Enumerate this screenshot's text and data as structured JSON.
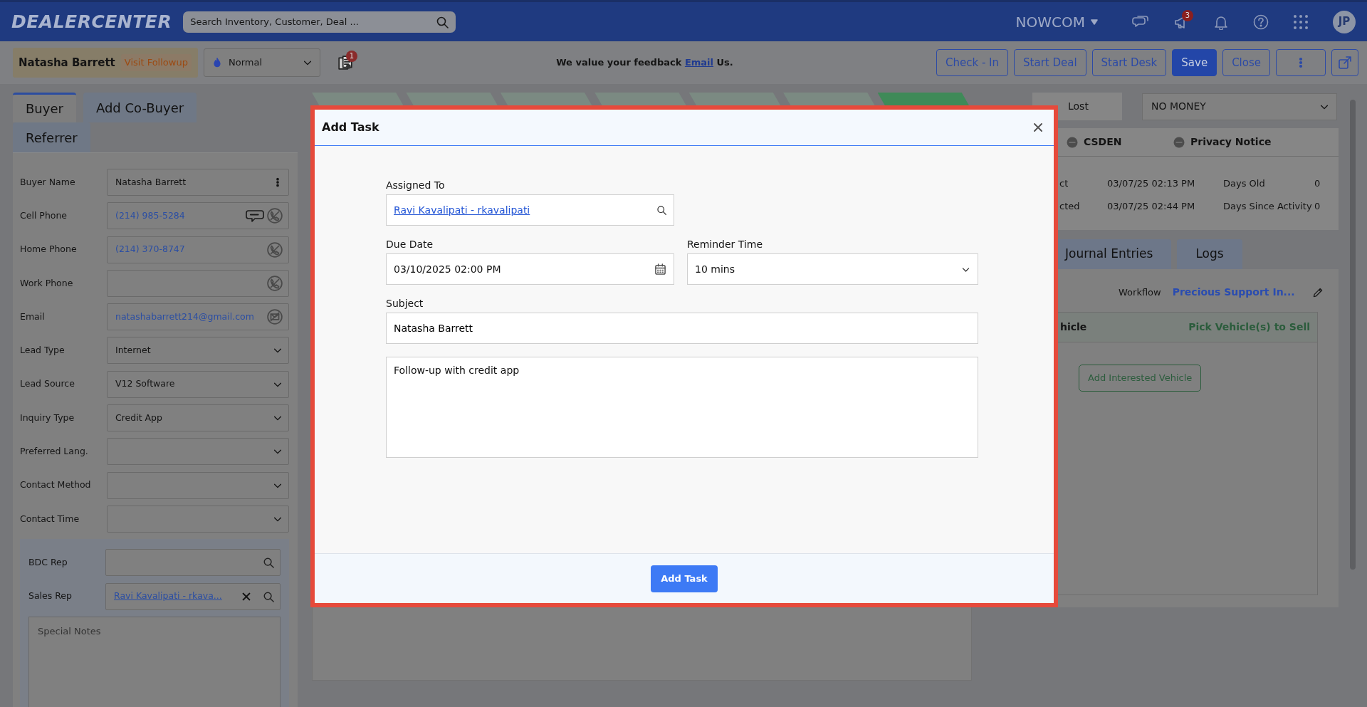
{
  "navbar": {
    "logo": "DEALERCENTER",
    "search_placeholder": "Search Inventory, Customer, Deal ...",
    "org": "NOWCOM",
    "announcements_badge": "3",
    "avatar_initials": "JP"
  },
  "header": {
    "customer_name": "Natasha Barrett",
    "status_tag": "Visit Followup",
    "priority": "Normal",
    "documents_badge": "1",
    "feedback": {
      "text": "We value your feedback",
      "link": "Email",
      "suffix": "Us."
    },
    "buttons": [
      {
        "kind": "outline",
        "label": "Check - In"
      },
      {
        "kind": "outline",
        "label": "Start Deal"
      },
      {
        "kind": "outline",
        "label": "Start Desk"
      },
      {
        "kind": "primary",
        "label": "Save"
      },
      {
        "kind": "outline",
        "label": "Close"
      },
      {
        "kind": "more"
      },
      {
        "kind": "popout"
      }
    ]
  },
  "buyer_tabs": [
    {
      "label": "Buyer",
      "selected": true
    },
    {
      "label": "Add Co-Buyer",
      "selected": false
    },
    {
      "label": "Referrer",
      "selected": false
    }
  ],
  "buyer_fields": [
    {
      "label": "Buyer Name",
      "kind": "menu",
      "value": "Natasha Barrett"
    },
    {
      "label": "Cell Phone",
      "kind": "phone-sms",
      "value": "(214) 985-5284"
    },
    {
      "label": "Home Phone",
      "kind": "phone",
      "value": "(214) 370-8747"
    },
    {
      "label": "Work Phone",
      "kind": "phone"
    },
    {
      "label": "Email",
      "kind": "email",
      "value": "natashabarrett214@gmail.com"
    },
    {
      "label": "Lead Type",
      "kind": "select",
      "value": "Internet"
    },
    {
      "label": "Lead Source",
      "kind": "select",
      "value": "V12 Software"
    },
    {
      "label": "Inquiry Type",
      "kind": "select",
      "value": "Credit App"
    },
    {
      "label": "Preferred Lang.",
      "kind": "select"
    },
    {
      "label": "Contact Method",
      "kind": "select"
    },
    {
      "label": "Contact Time",
      "kind": "select"
    }
  ],
  "reps": [
    {
      "label": "BDC Rep",
      "kind": "search"
    },
    {
      "label": "Sales Rep",
      "kind": "search-clear",
      "value": "Ravi Kavalipati - rkava..."
    }
  ],
  "special_notes_placeholder": "Special Notes",
  "pipeline_steps": [
    {
      "selected": false
    },
    {
      "selected": false
    },
    {
      "selected": false
    },
    {
      "selected": false
    },
    {
      "selected": false
    },
    {
      "selected": false
    },
    {
      "selected": true
    }
  ],
  "right_panel": {
    "lost_label": "Lost",
    "lost_reason": "NO MONEY",
    "consents": [
      {
        "label": "CSDEN"
      },
      {
        "label": "Privacy Notice"
      }
    ],
    "stats": [
      {
        "label": "ct",
        "value": "03/07/25 02:13 PM",
        "metric": "Days Old",
        "count": "0"
      },
      {
        "label": "cted",
        "value": "03/07/25 02:44 PM",
        "metric": "Days Since Activity",
        "count": "0"
      }
    ],
    "tabs": [
      {
        "label": "Journal Entries",
        "selected": false
      },
      {
        "label": "Logs",
        "selected": false
      }
    ],
    "workflow_label": "Workflow",
    "workflow_value": "Precious Support In...",
    "vehicle_title": "hicle",
    "vehicle_action": "Pick Vehicle(s) to Sell",
    "vehicle_button": "Add Interested Vehicle"
  },
  "modal": {
    "title": "Add Task",
    "assigned_label": "Assigned To",
    "assigned_value": "Ravi Kavalipati - rkavalipati",
    "due_label": "Due Date",
    "due_value": "03/10/2025 02:00 PM",
    "reminder_label": "Reminder Time",
    "reminder_value": "10 mins",
    "subject_label": "Subject",
    "subject_value": "Natasha Barrett",
    "notes_value": "Follow-up with credit app",
    "submit": "Add Task"
  }
}
